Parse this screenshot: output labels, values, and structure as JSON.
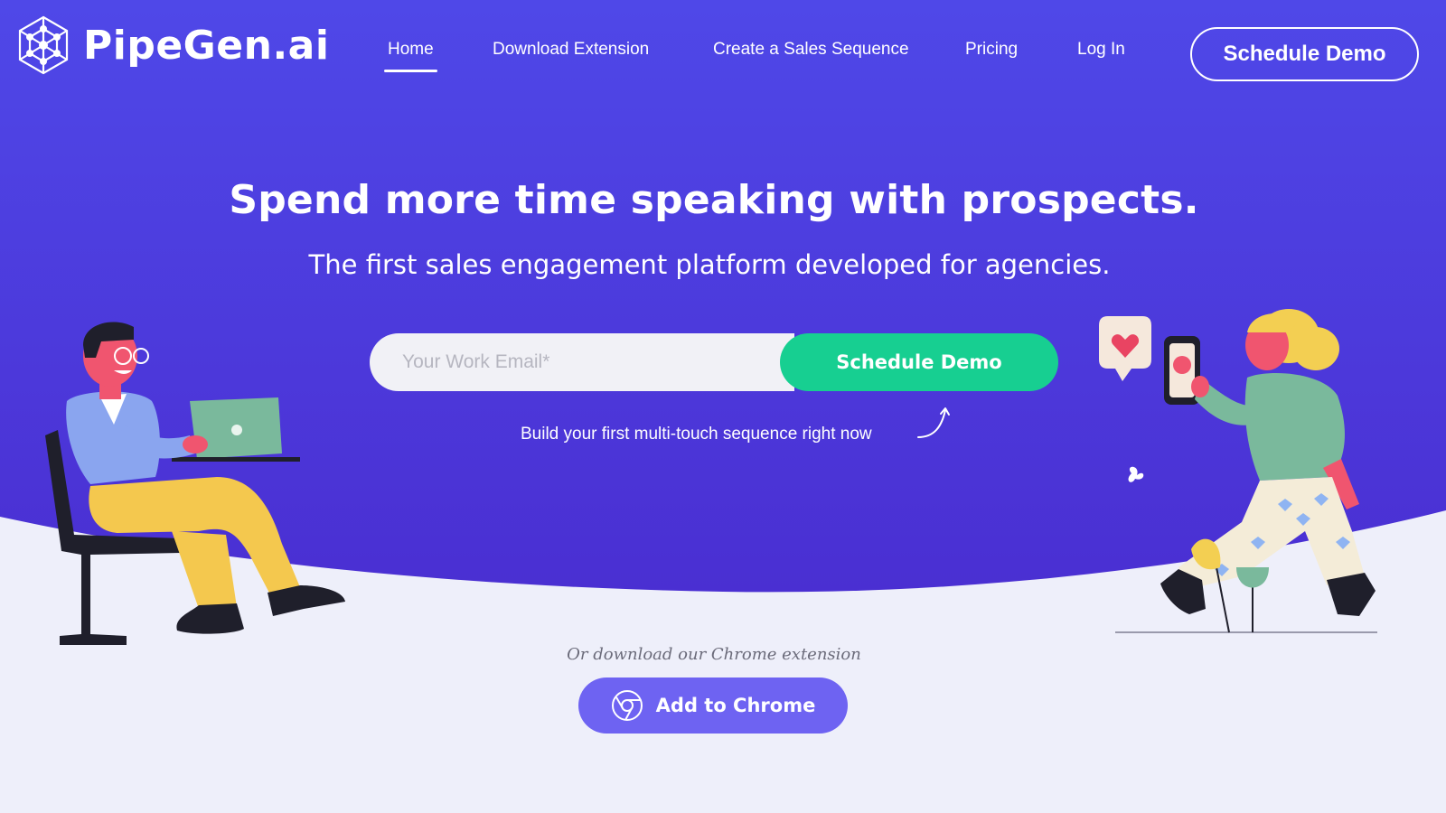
{
  "brand": {
    "name": "PipeGen.ai",
    "primary_color": "#4c3ee0",
    "accent_color": "#17cf91",
    "button_color": "#6e63f2"
  },
  "nav": {
    "items": [
      {
        "label": "Home",
        "active": true
      },
      {
        "label": "Download Extension",
        "active": false
      },
      {
        "label": "Create a Sales Sequence",
        "active": false
      },
      {
        "label": "Pricing",
        "active": false
      },
      {
        "label": "Log In",
        "active": false
      }
    ],
    "cta_label": "Schedule Demo"
  },
  "hero": {
    "headline": "Spend more time speaking with prospects.",
    "subheadline": "The first sales engagement platform developed for agencies.",
    "email_placeholder": "Your Work Email*",
    "submit_label": "Schedule Demo",
    "hint": "Build your first multi-touch sequence right now"
  },
  "chrome": {
    "caption": "Or download our Chrome extension",
    "button_label": "Add to Chrome",
    "icon": "chrome-icon"
  },
  "illustrations": {
    "left": "man-with-laptop-illustration",
    "right": "woman-with-phone-illustration"
  }
}
